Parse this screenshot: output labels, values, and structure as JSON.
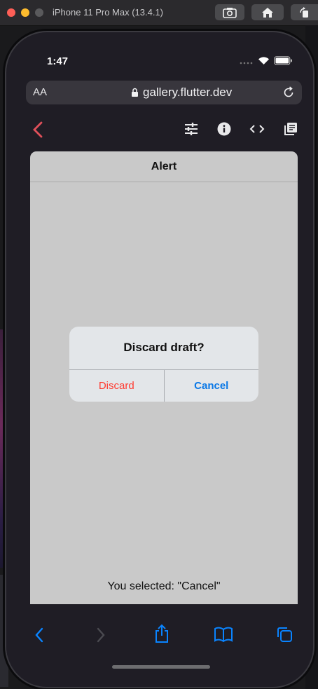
{
  "window": {
    "title": "iPhone 11 Pro Max (13.4.1)",
    "buttons": [
      "screenshot-icon",
      "home-icon",
      "rotate-icon"
    ]
  },
  "status_bar": {
    "time": "1:47",
    "icons": [
      "signal-icon",
      "wifi-icon",
      "battery-icon"
    ]
  },
  "browser": {
    "text_size_label": "AA",
    "url": "gallery.flutter.dev",
    "icons": [
      "lock-icon",
      "reload-icon"
    ]
  },
  "app_bar": {
    "icons": [
      "back-icon",
      "tune-icon",
      "info-icon",
      "code-icon",
      "library-books-icon"
    ]
  },
  "page": {
    "title": "Alert",
    "selected_text": "You selected: \"Cancel\""
  },
  "alert": {
    "title": "Discard draft?",
    "discard_label": "Discard",
    "cancel_label": "Cancel"
  },
  "safari_toolbar": {
    "icons": [
      "nav-back-icon",
      "nav-forward-icon",
      "share-icon",
      "bookmarks-icon",
      "tabs-icon"
    ]
  },
  "colors": {
    "accent_red": "#ff3b30",
    "accent_blue": "#0a78e6",
    "back_chevron": "#e0505a"
  }
}
